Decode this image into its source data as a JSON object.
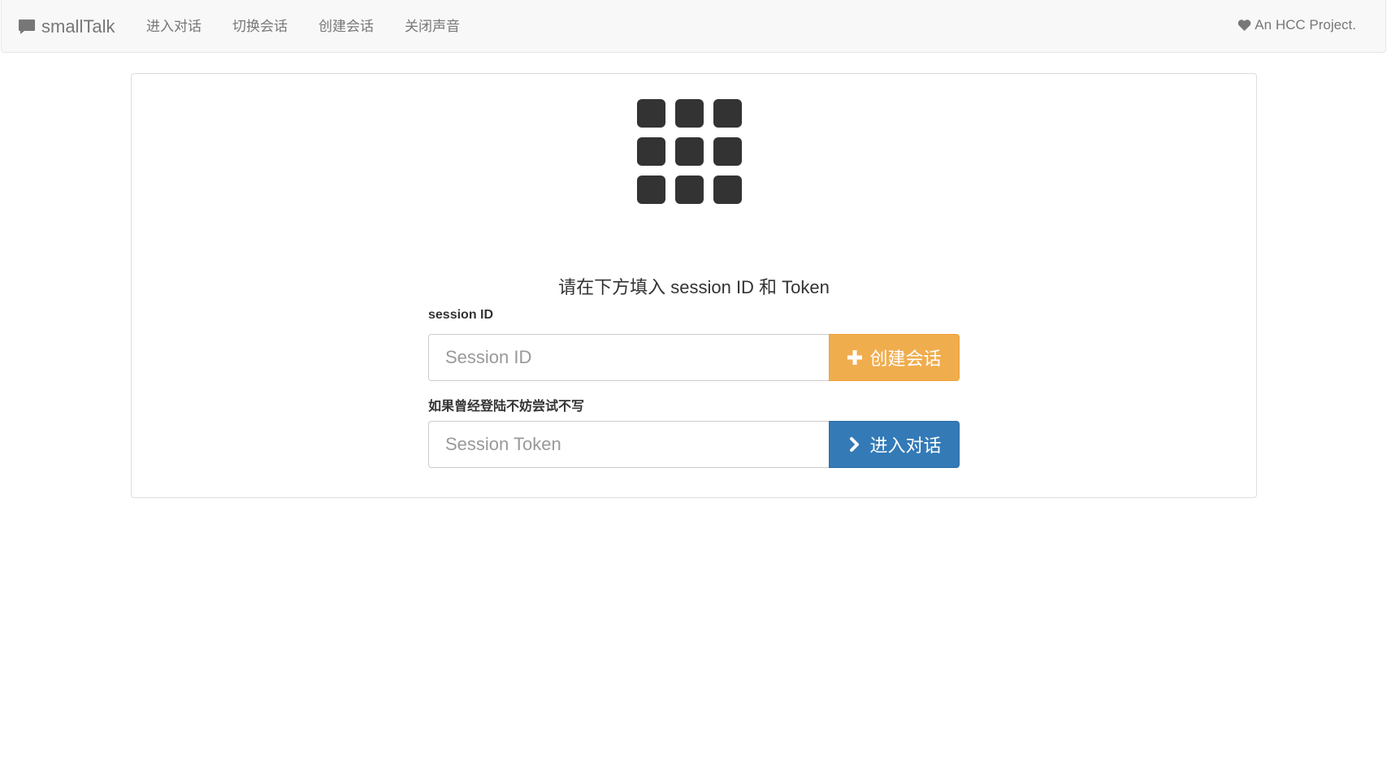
{
  "navbar": {
    "brand": "smallTalk",
    "items": [
      {
        "label": "进入对话"
      },
      {
        "label": "切换会话"
      },
      {
        "label": "创建会话"
      },
      {
        "label": "关闭声音"
      }
    ],
    "right_text": "An HCC Project."
  },
  "main": {
    "heading": "请在下方填入 session ID 和 Token",
    "session_id_label": "session ID",
    "session_id_placeholder": "Session ID",
    "session_id_value": "",
    "create_button": "创建会话",
    "token_label": "如果曾经登陆不妨尝试不写",
    "token_placeholder": "Session Token",
    "token_value": "",
    "enter_button": "进入对话"
  },
  "icons": {
    "brand": "comment-icon",
    "right": "heart-icon",
    "logo": "grid-icon",
    "create": "plus-icon",
    "enter": "chevron-right-icon"
  },
  "colors": {
    "warning": "#f0ad4e",
    "primary": "#337ab7",
    "navbar_bg": "#f8f8f8"
  }
}
